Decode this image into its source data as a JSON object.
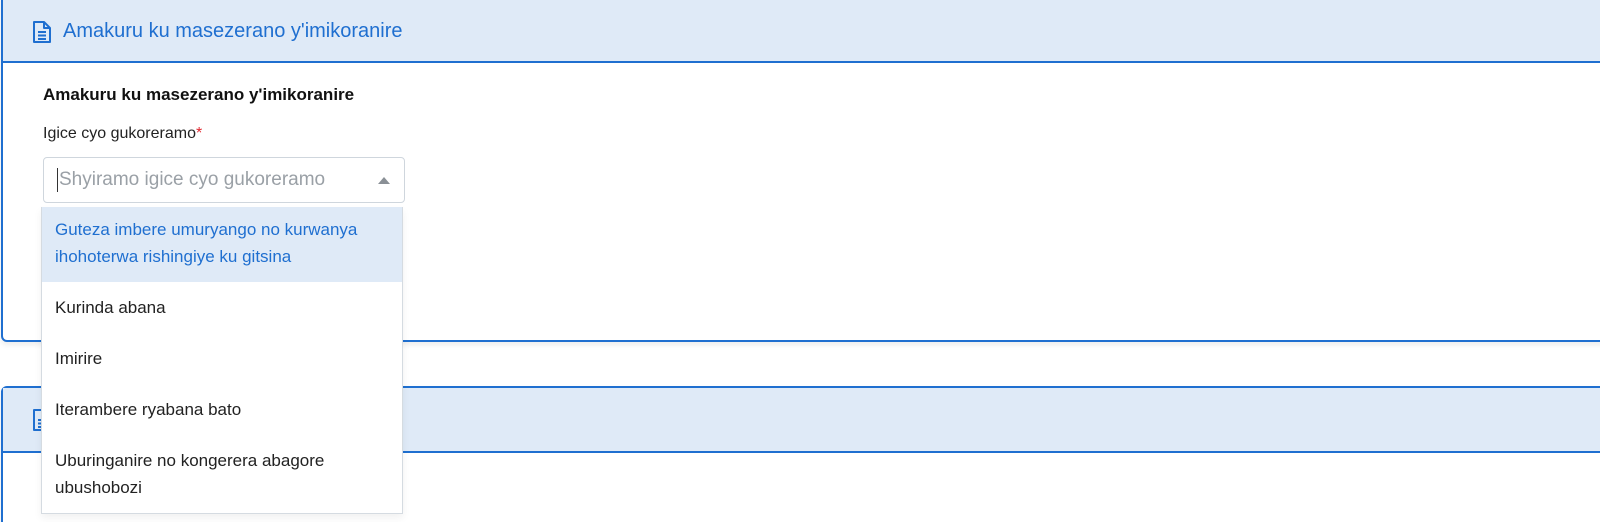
{
  "panel1": {
    "header_title": "Amakuru ku masezerano y'imikoranire",
    "icon": "document-icon",
    "section_title": "Amakuru ku masezerano y'imikoranire",
    "field": {
      "label": "Igice cyo gukoreramo",
      "required_mark": "*",
      "placeholder": "Shyiramo igice cyo gukoreramo",
      "value": ""
    },
    "dropdown_options": [
      "Guteza imbere umuryango no kurwanya ihohoterwa rishingiye ku gitsina",
      "Kurinda abana",
      "Imirire",
      "Iterambere ryabana bato",
      "Uburinganire no kongerera abagore ubushobozi"
    ],
    "highlighted_option_index": 0
  },
  "panel2": {
    "icon": "document-icon"
  },
  "colors": {
    "accent": "#1f6fd0",
    "header_bg": "#dfeaf7",
    "required": "#e0262e"
  }
}
